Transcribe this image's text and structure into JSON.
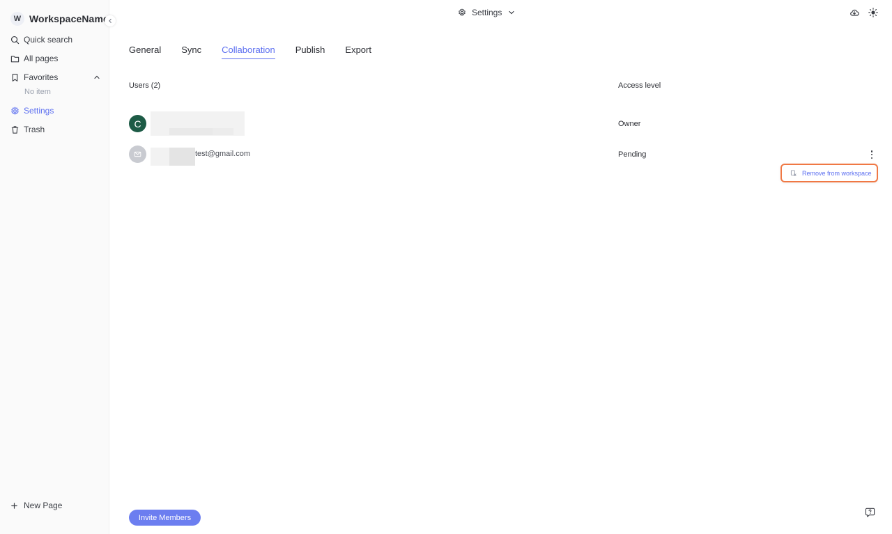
{
  "workspace": {
    "avatar_letter": "W",
    "name": "WorkspaceName"
  },
  "sidebar": {
    "items": [
      {
        "label": "Quick search",
        "icon": "search-icon"
      },
      {
        "label": "All pages",
        "icon": "folder-icon"
      },
      {
        "label": "Favorites",
        "icon": "bookmark-icon"
      },
      {
        "label": "Settings",
        "icon": "gear-icon"
      },
      {
        "label": "Trash",
        "icon": "trash-icon"
      }
    ],
    "favorites_empty": "No item",
    "new_page": "New Page"
  },
  "header": {
    "title": "Settings"
  },
  "tabs": [
    {
      "label": "General"
    },
    {
      "label": "Sync"
    },
    {
      "label": "Collaboration"
    },
    {
      "label": "Publish"
    },
    {
      "label": "Export"
    }
  ],
  "active_tab": "Collaboration",
  "table": {
    "users_header": "Users (2)",
    "access_header": "Access level",
    "rows": [
      {
        "avatar_letter": "C",
        "email": "",
        "access": "Owner"
      },
      {
        "avatar_letter": "",
        "email": "test@gmail.com",
        "access": "Pending"
      }
    ]
  },
  "context_menu": {
    "remove_label": "Remove from workspace"
  },
  "invite_button": "Invite Members",
  "colors": {
    "accent": "#5b6ef0",
    "button": "#6c7ef0",
    "owner_avatar": "#1d5b46",
    "highlight": "#f07844"
  }
}
